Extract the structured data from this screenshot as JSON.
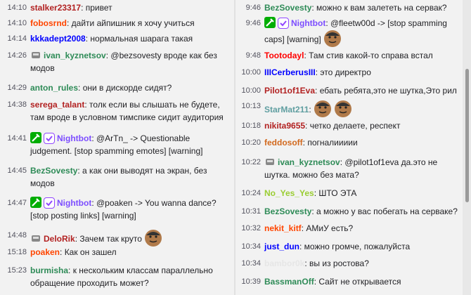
{
  "left_messages": [
    {
      "time": "14:10",
      "user": "stalker23317",
      "color": "#b22222",
      "badges": [],
      "text": "привет"
    },
    {
      "time": "14:10",
      "user": "fobosrnd",
      "color": "#ff4500",
      "badges": [],
      "text": "дайти айпишник я хочу учиться"
    },
    {
      "time": "14:14",
      "user": "kkkadept2008",
      "color": "#0000ff",
      "badges": [],
      "text": "нормальная шарага такая"
    },
    {
      "time": "14:26",
      "user": "ivan_kyznetsov",
      "color": "#2e8b57",
      "badges": [
        "sub-badge-icon"
      ],
      "text": "@bezsovesty вроде как без модов"
    },
    {
      "time": "14:29",
      "user": "anton_rules",
      "color": "#2e8b57",
      "badges": [],
      "text": "они в дискорде сидят?"
    },
    {
      "time": "14:38",
      "user": "serega_talant",
      "color": "#b22222",
      "badges": [],
      "text": "толк если вы слышать не будете, там вроде в условном тимспике сидит аудитория"
    },
    {
      "time": "14:41",
      "user": "Nightbot",
      "color": "#7c4dff",
      "badges": [
        "moderator-badge-icon",
        "verified-badge-icon"
      ],
      "text": "@ArTn_ -> Questionable judgement. [stop spamming emotes] [warning]"
    },
    {
      "time": "14:45",
      "user": "BezSovesty",
      "color": "#2e8b57",
      "badges": [],
      "text": "а как они выводят на экран, без модов"
    },
    {
      "time": "14:47",
      "user": "Nightbot",
      "color": "#7c4dff",
      "badges": [
        "moderator-badge-icon",
        "verified-badge-icon"
      ],
      "text": "@poaken -> You wanna dance? [stop posting links] [warning]"
    },
    {
      "time": "14:48",
      "user": "DeloRik",
      "color": "#b22222",
      "badges": [
        "sub-badge-icon"
      ],
      "text": "Зачем так круто"
    },
    {
      "time": "15:18",
      "user": "poaken",
      "color": "#ff4500",
      "badges": [],
      "text": "Как он зашел"
    },
    {
      "time": "15:23",
      "user": "burmisha",
      "color": "#2e8b57",
      "badges": [],
      "text": "к нескольким классам параллельно обращение проходить может?"
    }
  ],
  "right_messages": [
    {
      "time": "9:46",
      "user": "BezSovesty",
      "color": "#2e8b57",
      "badges": [],
      "text": "можно к вам залететь на сервак?"
    },
    {
      "time": "9:46",
      "user": "Nightbot",
      "color": "#7c4dff",
      "badges": [
        "moderator-badge-icon",
        "verified-badge-icon"
      ],
      "text": "@fleetw00d -> [stop spamming caps] [warning]"
    },
    {
      "time": "9:48",
      "user": "Tootodayl",
      "color": "#ff0000",
      "badges": [],
      "text": "Там стив какой-то справа встал"
    },
    {
      "time": "10:00",
      "user": "IIICerberusIII",
      "color": "#0000ff",
      "badges": [],
      "text": "это директро"
    },
    {
      "time": "10:00",
      "user": "Pilot1of1Eva",
      "color": "#b22222",
      "badges": [],
      "text": "ебать ребята,это не шутка,Это рил"
    },
    {
      "time": "10:13",
      "user": "StarMat211",
      "color": "#5f9ea0",
      "badges": [],
      "text": ""
    },
    {
      "time": "10:18",
      "user": "nikita9655",
      "color": "#b22222",
      "badges": [],
      "text": "четко делаете, респект"
    },
    {
      "time": "10:20",
      "user": "feddosoff",
      "color": "#d2691e",
      "badges": [],
      "text": "погналиииии"
    },
    {
      "time": "10:22",
      "user": "ivan_kyznetsov",
      "color": "#2e8b57",
      "badges": [
        "sub-badge-icon"
      ],
      "text": "@pilot1of1eva да.это не шутка. можно без мата?"
    },
    {
      "time": "10:24",
      "user": "No_Yes_Yes",
      "color": "#9acd32",
      "badges": [],
      "text": "ШТО ЭТА"
    },
    {
      "time": "10:31",
      "user": "BezSovesty",
      "color": "#2e8b57",
      "badges": [],
      "text": "а можно у вас побегать на серваке?"
    },
    {
      "time": "10:32",
      "user": "nekit_kitf",
      "color": "#ff4500",
      "badges": [],
      "text": "АМиУ есть?"
    },
    {
      "time": "10:34",
      "user": "just_dun",
      "color": "#0000ff",
      "badges": [],
      "text": "можно громче, пожалуйста"
    },
    {
      "time": "10:34",
      "user": "bambor0k",
      "color": "#e6e6e6",
      "badges": [],
      "text": "вы из ростова?"
    },
    {
      "time": "10:39",
      "user": "BassmanOff",
      "color": "#2e8b57",
      "badges": [],
      "text": "Сайт не открывается"
    }
  ]
}
